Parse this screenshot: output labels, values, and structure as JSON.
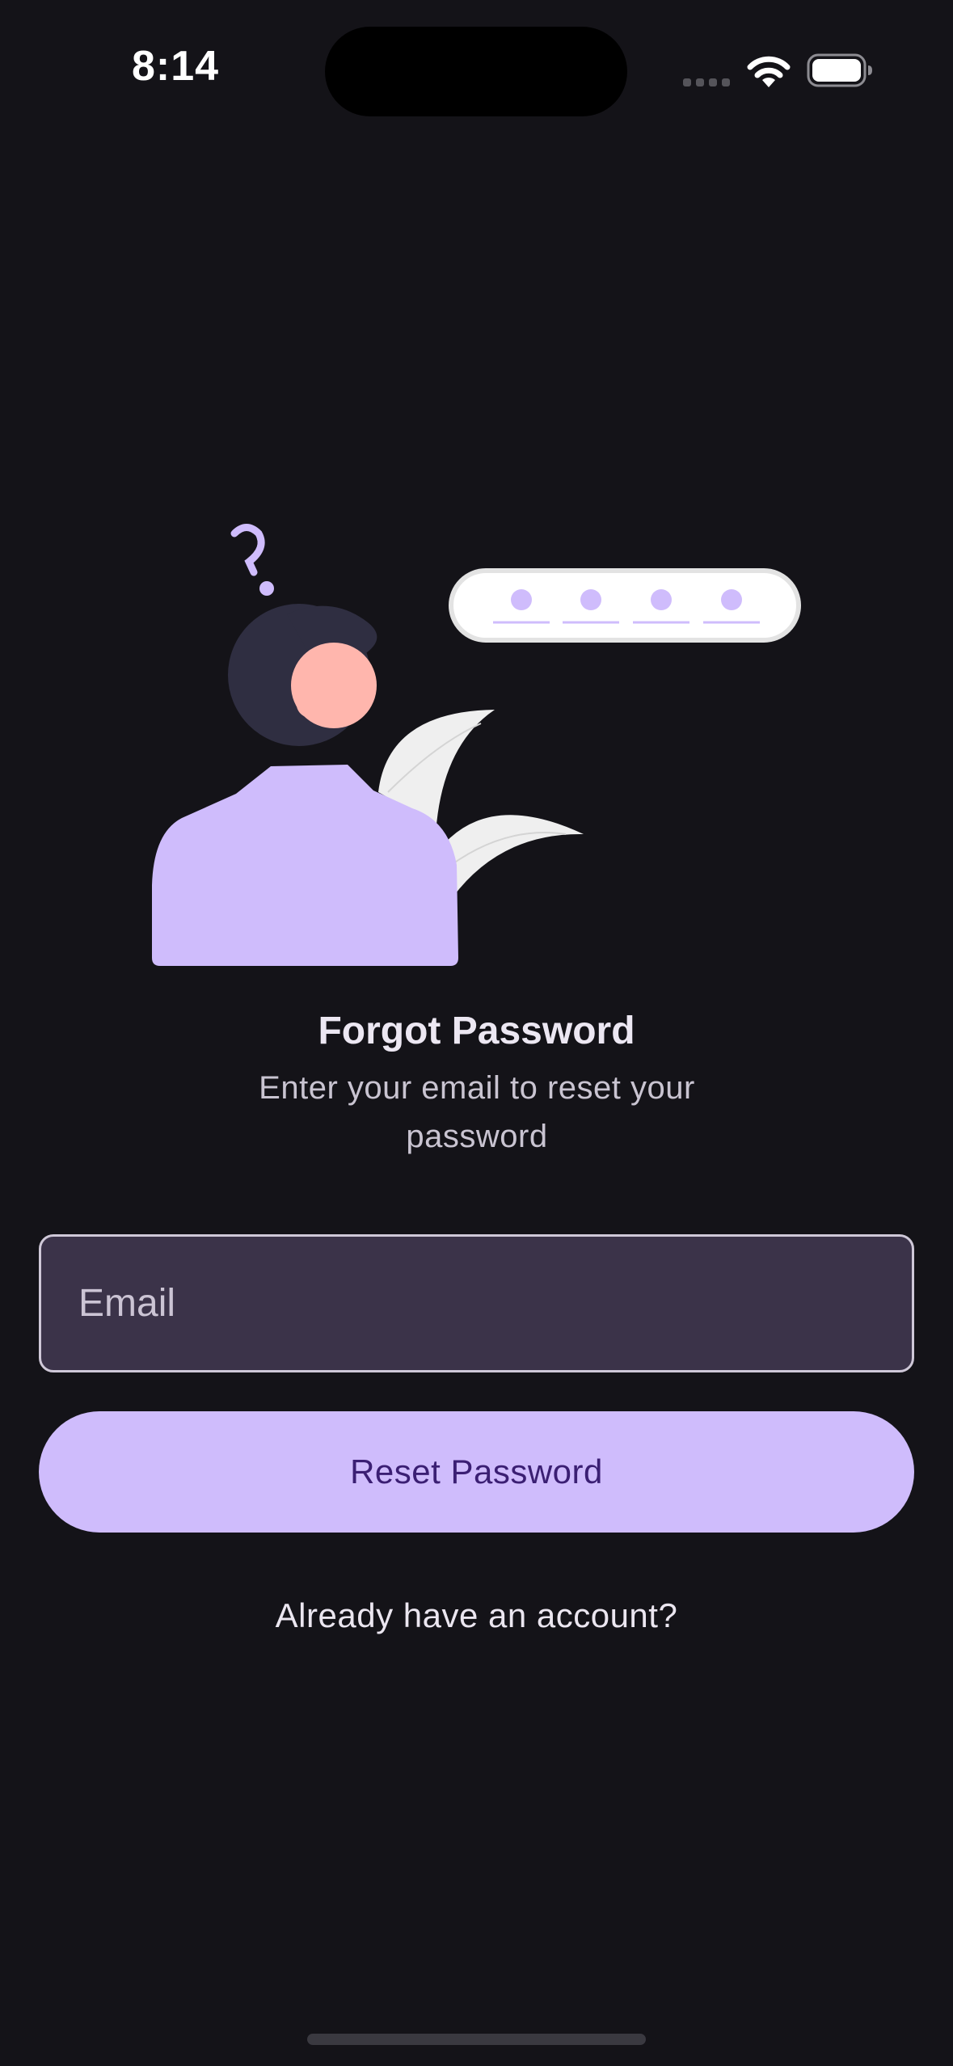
{
  "status_bar": {
    "time": "8:14"
  },
  "icons": {
    "signal": "cellular-signal-icon",
    "wifi": "wifi-icon",
    "battery": "battery-icon"
  },
  "colors": {
    "background": "#141318",
    "accent": "#cfbcfc",
    "button_text": "#3b1f73",
    "field_background": "#3b3349",
    "illustration_skin": "#ffb6ad",
    "illustration_hair": "#2f2e41",
    "illustration_leaf": "#efefef"
  },
  "screen": {
    "title": "Forgot Password",
    "subtitle": "Enter your email to reset your password",
    "email_placeholder": "Email",
    "email_value": "",
    "reset_button_label": "Reset Password",
    "account_link": "Already have an account?"
  }
}
